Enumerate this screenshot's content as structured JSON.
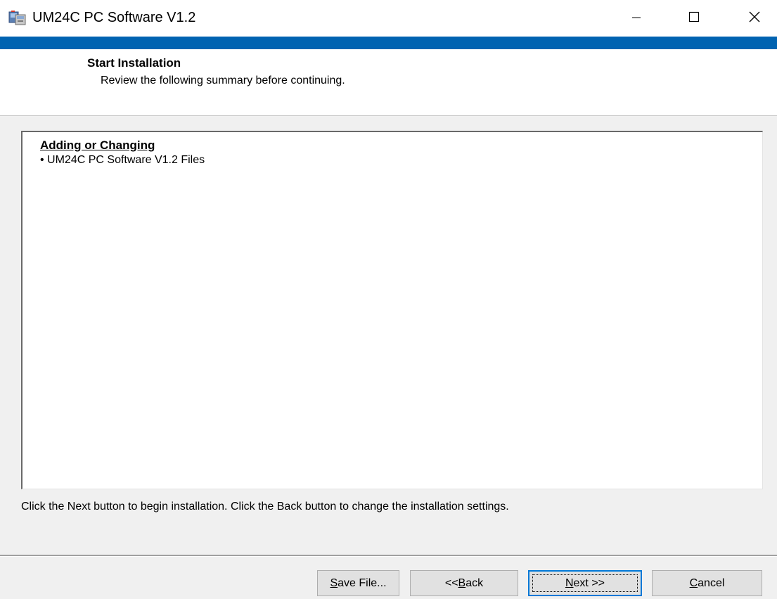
{
  "window": {
    "title": "UM24C PC Software V1.2",
    "accent_color": "#0063b1",
    "controls": {
      "minimize_icon": "minimize-icon",
      "maximize_icon": "maximize-icon",
      "close_icon": "close-icon"
    }
  },
  "header": {
    "title": "Start Installation",
    "subtitle": "Review the following summary before continuing."
  },
  "summary": {
    "heading": "Adding or Changing",
    "items": [
      "• UM24C PC Software V1.2 Files"
    ]
  },
  "instruction": "Click the Next button to begin installation.  Click the Back button to change the installation settings.",
  "buttons": {
    "save": {
      "prefix": "",
      "accel": "S",
      "rest": "ave File..."
    },
    "back": {
      "prefix": "<< ",
      "accel": "B",
      "rest": "ack"
    },
    "next": {
      "prefix": "",
      "accel": "N",
      "rest": "ext >>"
    },
    "cancel": {
      "prefix": "",
      "accel": "C",
      "rest": "ancel"
    }
  }
}
